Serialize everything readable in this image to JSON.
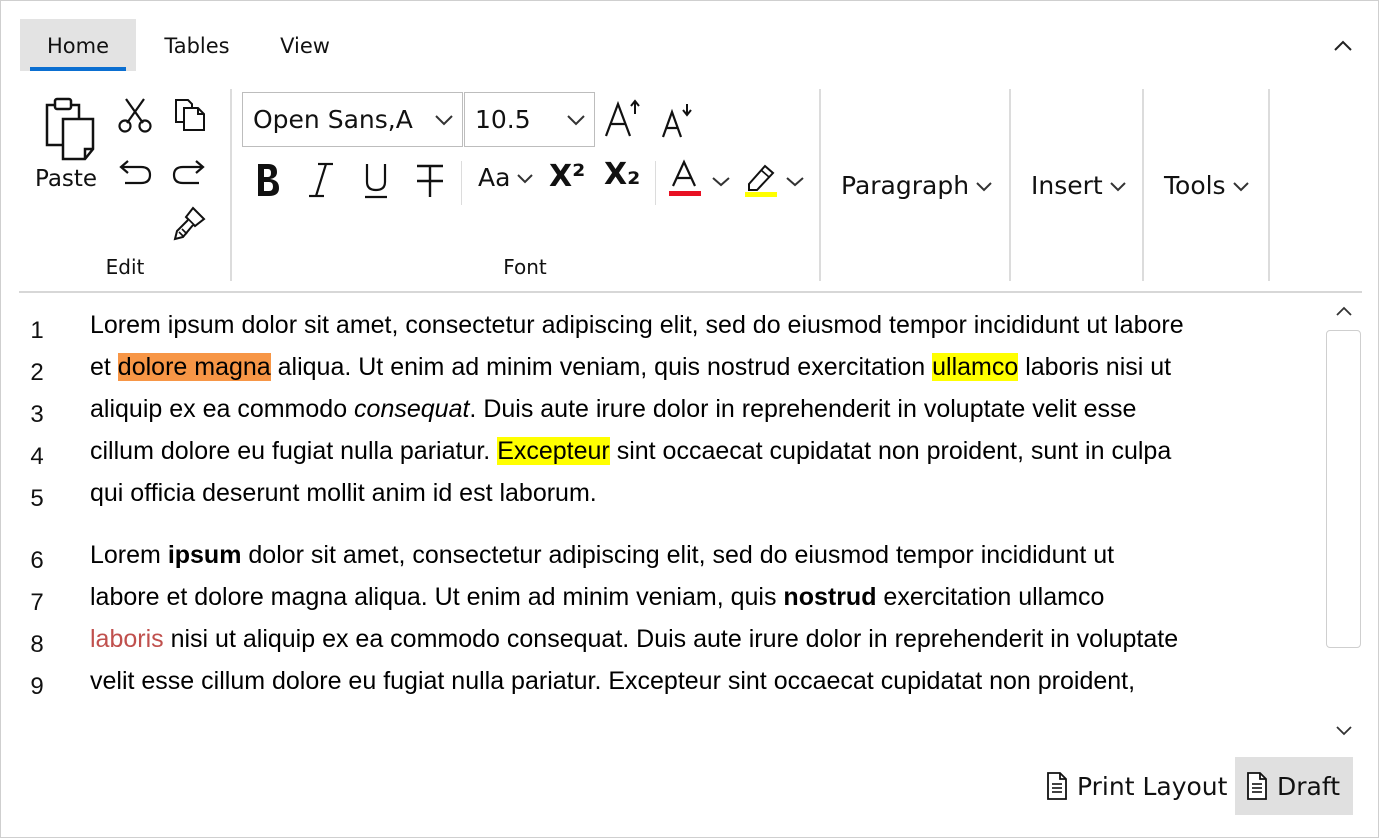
{
  "tabs": [
    {
      "label": "Home",
      "active": true
    },
    {
      "label": "Tables",
      "active": false
    },
    {
      "label": "View",
      "active": false
    }
  ],
  "ribbon": {
    "edit": {
      "paste_label": "Paste",
      "group_label": "Edit",
      "icons": [
        "paste-icon",
        "cut-icon",
        "copy-icon",
        "undo-icon",
        "redo-icon",
        "format-painter-icon"
      ]
    },
    "font": {
      "font_family": "Open Sans,A",
      "font_size": "10.5",
      "group_label": "Font",
      "change_case_label": "Aa",
      "superscript_label": "X²",
      "subscript_label": "X₂",
      "font_color": "#e81123",
      "highlight_color": "#ffff00",
      "icons": [
        "grow-font-icon",
        "shrink-font-icon",
        "bold-icon",
        "italic-icon",
        "underline-icon",
        "strikethrough-icon",
        "font-color-icon",
        "highlight-icon"
      ]
    },
    "paragraph_label": "Paragraph",
    "insert_label": "Insert",
    "tools_label": "Tools"
  },
  "document": {
    "paragraph1": {
      "line1": {
        "text": "Lorem ipsum dolor sit amet, consectetur adipiscing elit, sed do eiusmod tempor incididunt ut labore"
      },
      "line2": {
        "pre": "et ",
        "hl_orange": "dolore magna",
        "mid": " aliqua. Ut enim ad minim veniam, quis nostrud exercitation ",
        "hl_yellow": "ullamco",
        "post": " laboris nisi ut"
      },
      "line3": {
        "pre": "aliquip ex ea commodo ",
        "italic": "consequat",
        "post": ". Duis aute irure dolor in reprehenderit in voluptate velit esse"
      },
      "line4": {
        "pre": "cillum dolore eu fugiat nulla pariatur. ",
        "hl_yellow": "Excepteur",
        "post": " sint occaecat cupidatat non proident, sunt in culpa"
      },
      "line5": {
        "text": "qui officia deserunt mollit anim id est laborum."
      }
    },
    "paragraph2": {
      "line6": {
        "pre": "Lorem ",
        "bold": "ipsum",
        "post": " dolor sit amet, consectetur adipiscing elit, sed do eiusmod tempor incididunt ut"
      },
      "line7": {
        "pre": "labore et dolore magna aliqua. Ut enim ad minim veniam, quis ",
        "bold": "nostrud",
        "post": " exercitation ullamco"
      },
      "line8": {
        "red": "laboris",
        "post": " nisi ut aliquip ex ea commodo consequat. Duis aute irure dolor in reprehenderit in voluptate"
      },
      "line9": {
        "text": "velit esse cillum dolore eu fugiat nulla pariatur. Excepteur sint occaecat cupidatat non proident,"
      }
    },
    "line_numbers": [
      "1",
      "2",
      "3",
      "4",
      "5",
      "6",
      "7",
      "8",
      "9"
    ],
    "highlight_colors": {
      "orange": "#f79646",
      "yellow": "#ffff00",
      "red_text": "#c0504d"
    }
  },
  "status": {
    "print_layout_label": "Print Layout",
    "draft_label": "Draft",
    "active_view": "Draft"
  },
  "colors": {
    "accent": "#0b6fd1"
  }
}
